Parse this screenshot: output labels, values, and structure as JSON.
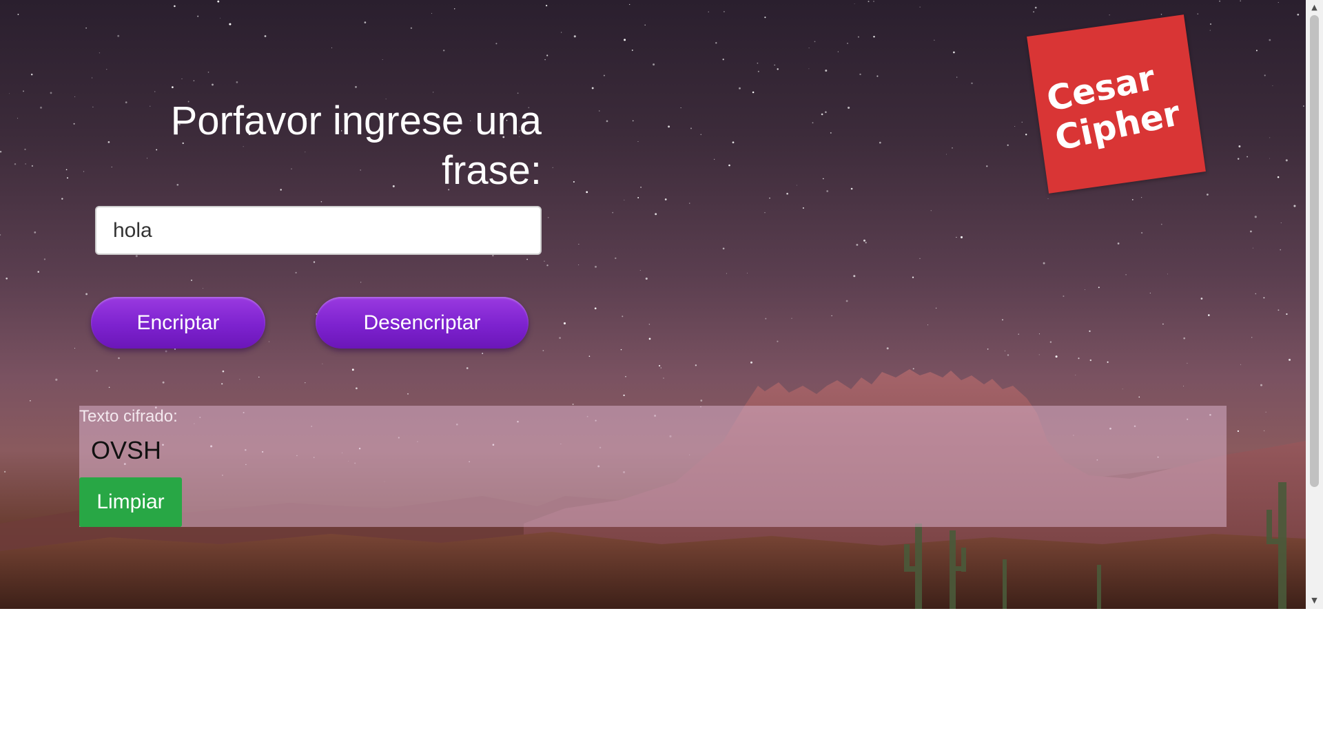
{
  "header": {
    "title": "Porfavor ingrese una frase:"
  },
  "form": {
    "input_value": "hola",
    "encrypt_label": "Encriptar",
    "decrypt_label": "Desencriptar"
  },
  "result": {
    "label": "Texto cifrado:",
    "value": "OVSH",
    "clear_label": "Limpiar"
  },
  "logo": {
    "line1": "Cesar",
    "line2": "Cipher"
  },
  "colors": {
    "button_purple": "#7d22cf",
    "clear_green": "#28a745",
    "logo_red": "#d93535"
  },
  "icons": {
    "scroll_up": "scroll-up-arrow-icon",
    "scroll_down": "scroll-down-arrow-icon"
  }
}
